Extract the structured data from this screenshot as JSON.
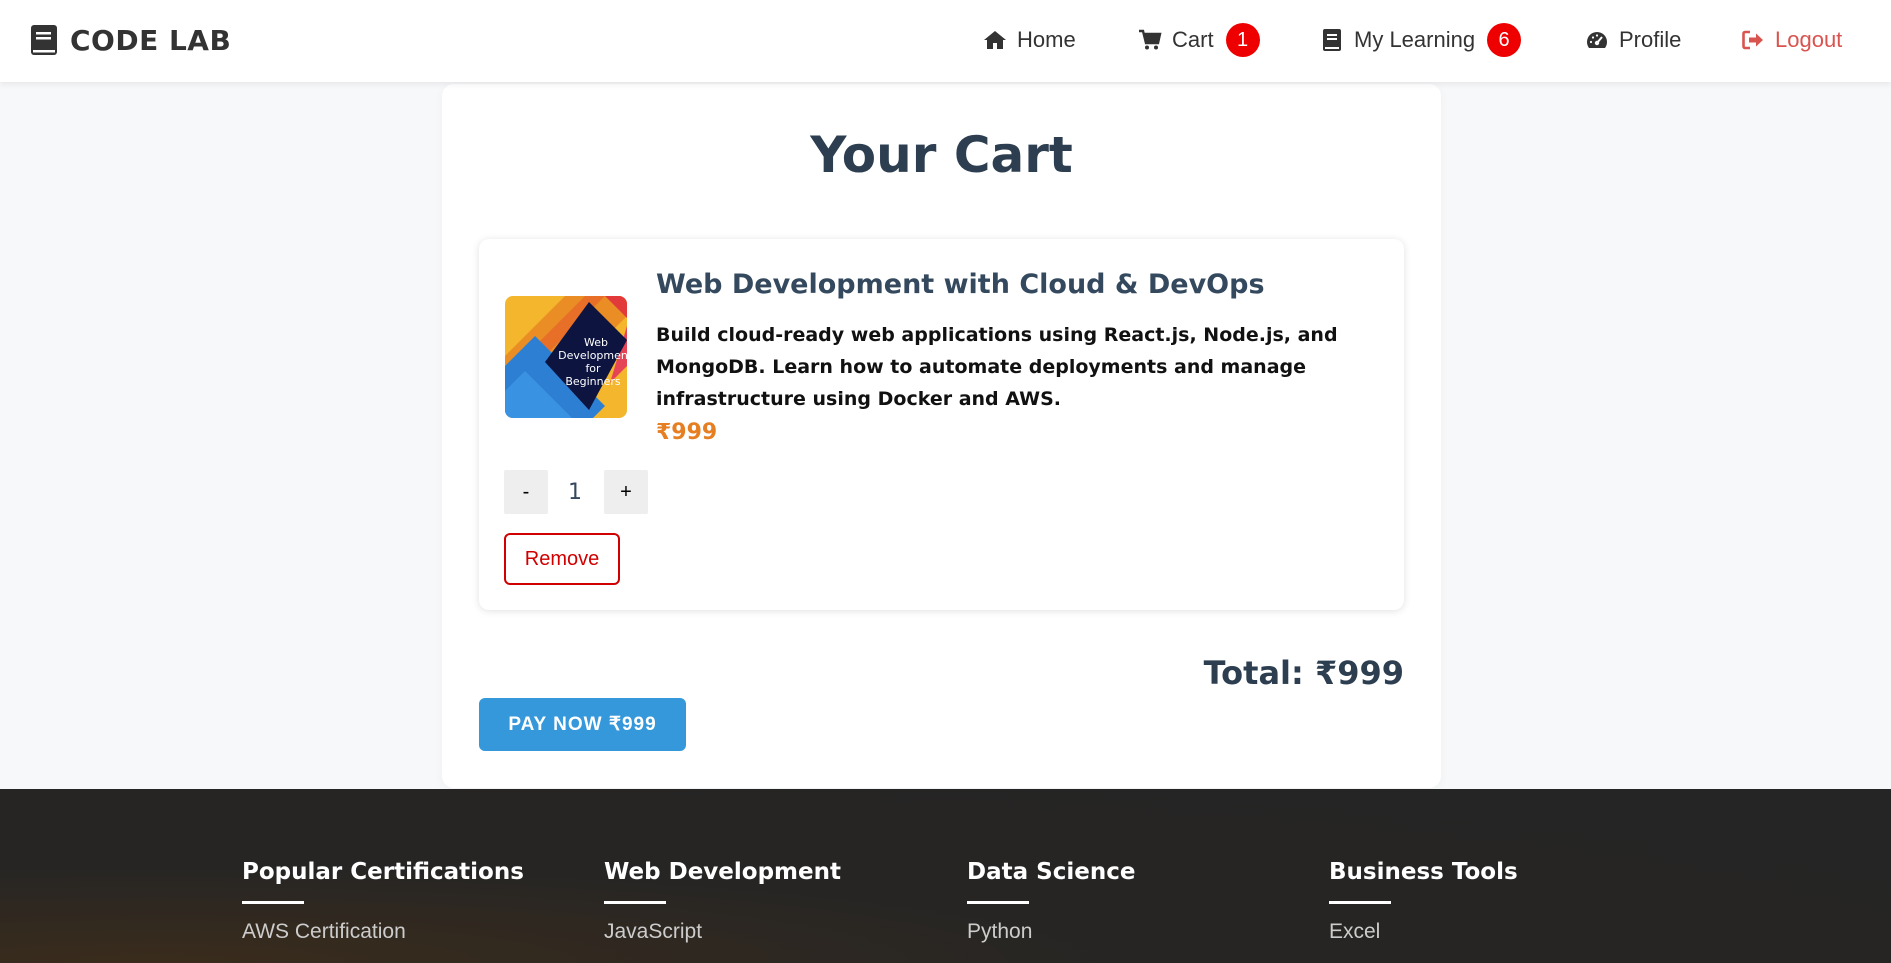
{
  "brand": {
    "name": "CODE LAB",
    "icon": "book-icon"
  },
  "nav": {
    "home": {
      "label": "Home",
      "icon": "home-icon"
    },
    "cart": {
      "label": "Cart",
      "icon": "cart-icon",
      "badge": "1"
    },
    "learning": {
      "label": "My Learning",
      "icon": "book-icon",
      "badge": "6"
    },
    "profile": {
      "label": "Profile",
      "icon": "dashboard-icon"
    },
    "logout": {
      "label": "Logout",
      "icon": "sign-out-icon"
    }
  },
  "cart": {
    "title": "Your Cart",
    "items": [
      {
        "thumb_text": [
          "Web",
          "Developmen",
          "for",
          "Beginners"
        ],
        "title": "Web Development with Cloud & DevOps",
        "description": "Build cloud-ready web applications using React.js, Node.js, and MongoDB. Learn how to automate deployments and manage infrastructure using Docker and AWS.",
        "price": "₹999",
        "qty_minus": "-",
        "quantity": "1",
        "qty_plus": "+",
        "remove_label": "Remove"
      }
    ],
    "total": "Total: ₹999",
    "pay_label": "PAY NOW ₹999"
  },
  "footer": {
    "columns": [
      {
        "heading": "Popular Certifications",
        "first_link": "AWS Certification"
      },
      {
        "heading": "Web Development",
        "first_link": "JavaScript"
      },
      {
        "heading": "Data Science",
        "first_link": "Python"
      },
      {
        "heading": "Business Tools",
        "first_link": "Excel"
      }
    ]
  },
  "colors": {
    "accent": "#3498db",
    "price": "#e67e22",
    "danger": "#d00000",
    "badge": "#ee0000",
    "heading": "#2c3e50",
    "footer_bg": "#252525"
  }
}
